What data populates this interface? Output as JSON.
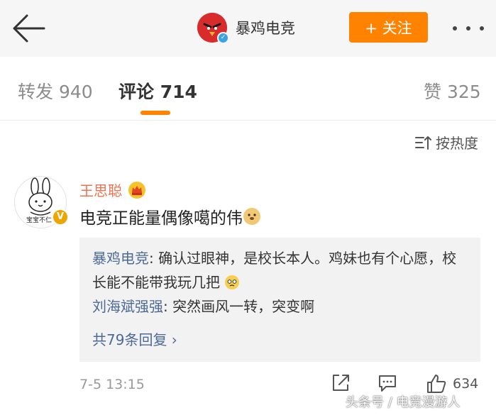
{
  "header": {
    "author_name": "暴鸡电竞",
    "follow_label": "+ 关注",
    "icons": [
      "back-arrow-icon",
      "verified-icon",
      "more-dots-icon"
    ]
  },
  "tabs": [
    {
      "label": "转发 940"
    },
    {
      "label": "评论 714",
      "active": true
    },
    {
      "label": "赞 325"
    }
  ],
  "sort": {
    "label": "按热度"
  },
  "comment": {
    "username": "王思聪",
    "avatar_caption": "宝宝不仁",
    "text": "电竞正能量偶像噶的伟",
    "time": "7-5 13:15",
    "like_count": "634",
    "replies": [
      {
        "name": "暴鸡电竞",
        "text": ": 确认过眼神，是校长本人。鸡妹也有个心愿，校长能不能带我玩几把"
      },
      {
        "name": "刘海斌强强",
        "text": ": 突然画风一转，突变啊"
      }
    ],
    "more_replies": "共79条回复 ›"
  },
  "watermark": "头条号 / 电竞漫游人",
  "colors": {
    "accent": "#ff8200",
    "link": "#4d6a96",
    "username": "#eb7350"
  }
}
